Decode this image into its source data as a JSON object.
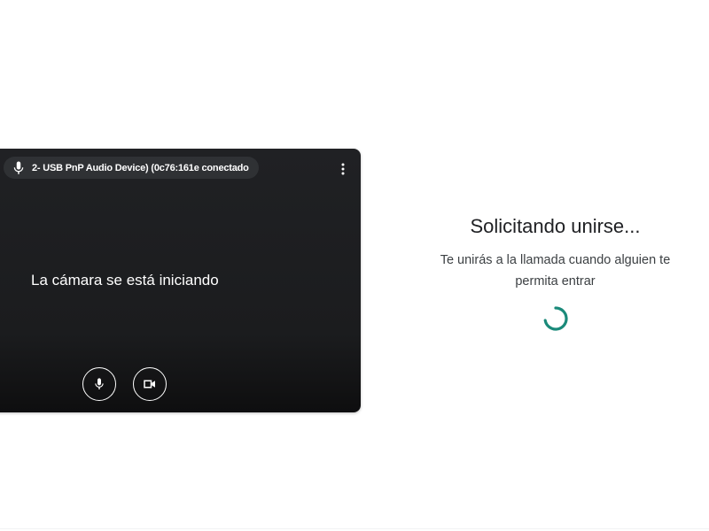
{
  "preview": {
    "mic_device_status": "2- USB PnP Audio Device) (0c76:161e  conectado",
    "camera_status": "La cámara se está iniciando",
    "mic_icon": "microphone-icon",
    "more_icon": "more-vert-icon",
    "mic_button_icon": "microphone-icon",
    "camera_button_icon": "videocam-icon"
  },
  "status": {
    "title": "Solicitando unirse...",
    "message": "Te unirás a la llamada cuando alguien te permita entrar"
  },
  "colors": {
    "preview_background": "#202124",
    "spinner": "#1e8e3e",
    "title_text": "#202124"
  }
}
